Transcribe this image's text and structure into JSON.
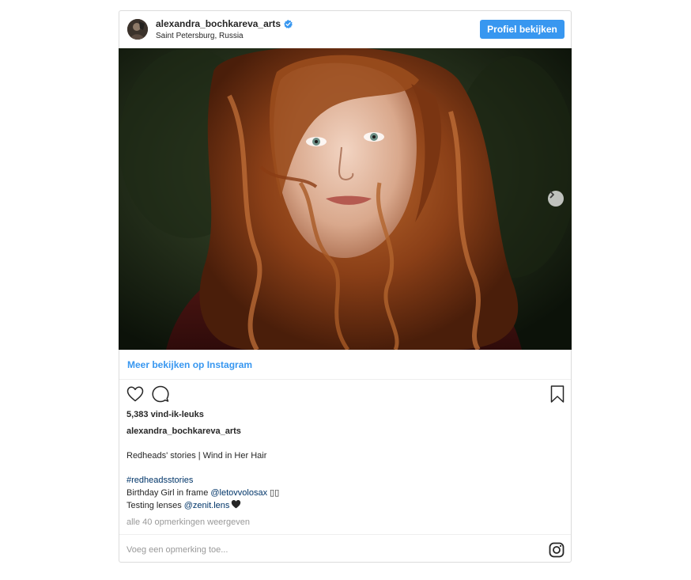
{
  "post": {
    "username": "alexandra_bochkareva_arts",
    "location": "Saint Petersburg, Russia",
    "profile_button": "Profiel bekijken",
    "more_link": "Meer bekijken op Instagram",
    "likes": "5,383 vind-ik-leuks",
    "caption_user": "alexandra_bochkareva_arts",
    "caption": {
      "title": "Redheads' stories | Wind in Her Hair",
      "hashtag": "#redheadsstories",
      "line1_text": "Birthday Girl in frame ",
      "line1_mention": "@letovvolosax",
      "line1_suffix": " ▯▯",
      "line2_text": "Testing lenses ",
      "line2_mention": "@zenit.lens"
    },
    "view_comments": "alle 40 opmerkingen weergeven",
    "comment_placeholder": "Voeg een opmerking toe..."
  },
  "icons": {
    "verified": "verified-badge-icon",
    "heart": "heart-icon",
    "comment": "comment-icon",
    "bookmark": "bookmark-icon",
    "instagram": "instagram-icon",
    "next": "chevron-right-icon"
  },
  "colors": {
    "accent": "#3897f0",
    "link": "#003569",
    "muted": "#999999",
    "text": "#262626",
    "border": "#dbdbdb"
  }
}
